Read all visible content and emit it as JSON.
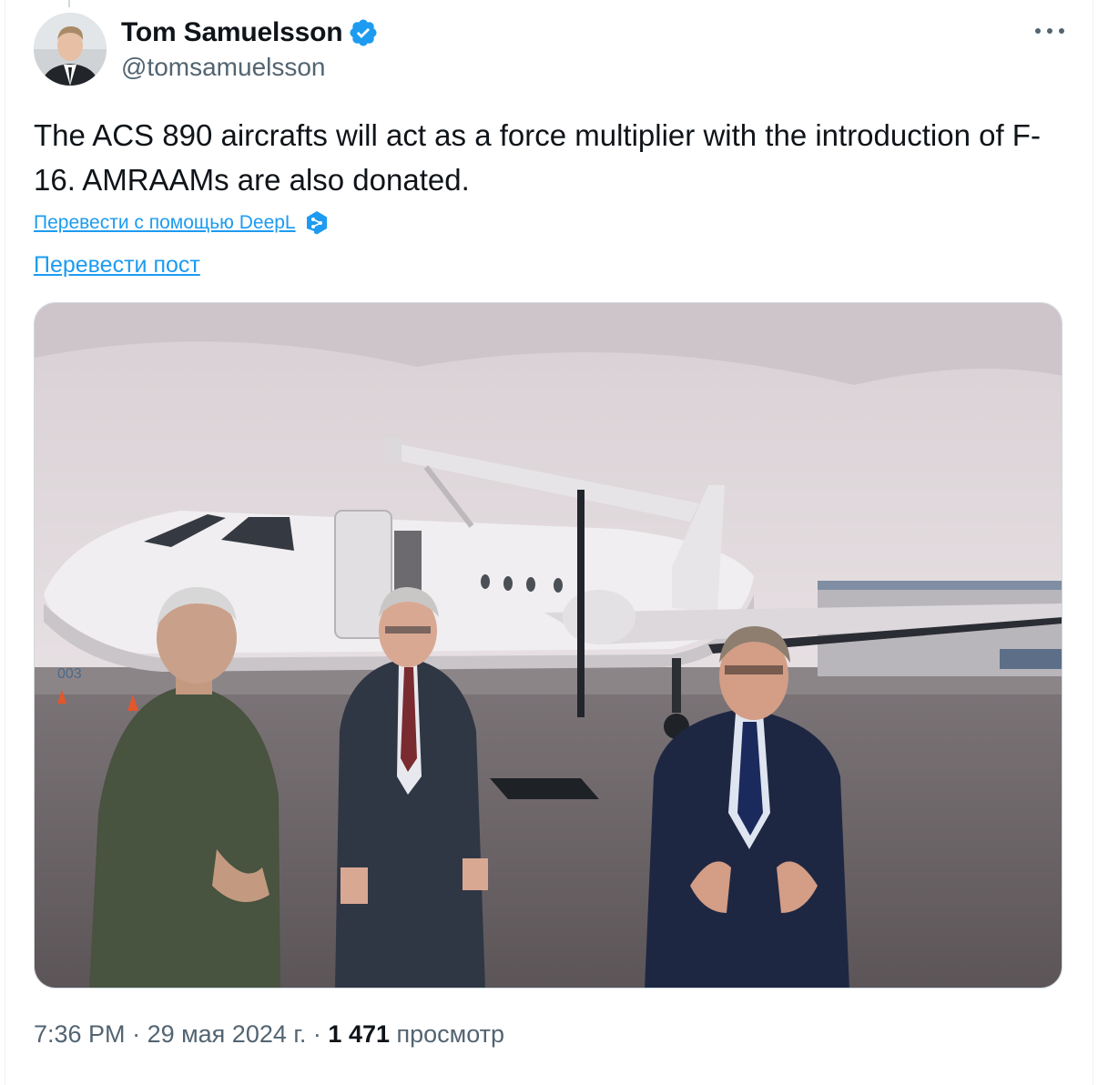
{
  "author": {
    "name": "Tom Samuelsson",
    "handle": "@tomsamuelsson",
    "verified": true
  },
  "post": {
    "text": "The ACS 890 aircrafts will act as a force multiplier with the introduction of F-16. AMRAAMs are also donated.",
    "translate_deepl_label": "Перевести с помощью DeepL",
    "translate_post_label": "Перевести пост"
  },
  "media": {
    "aircraft_tail_number": "003"
  },
  "meta": {
    "time": "7:36 PM",
    "separator": " · ",
    "date": "29 мая 2024 г.",
    "views_count": "1 471",
    "views_label": " просмотр"
  },
  "colors": {
    "link": "#1d9bf0",
    "verified_badge": "#1d9bf0",
    "secondary_text": "#536471",
    "primary_text": "#0f1419"
  },
  "icons": {
    "more": "more-dots-icon",
    "verified": "verified-badge-icon",
    "deepl": "deepl-logo-icon"
  }
}
